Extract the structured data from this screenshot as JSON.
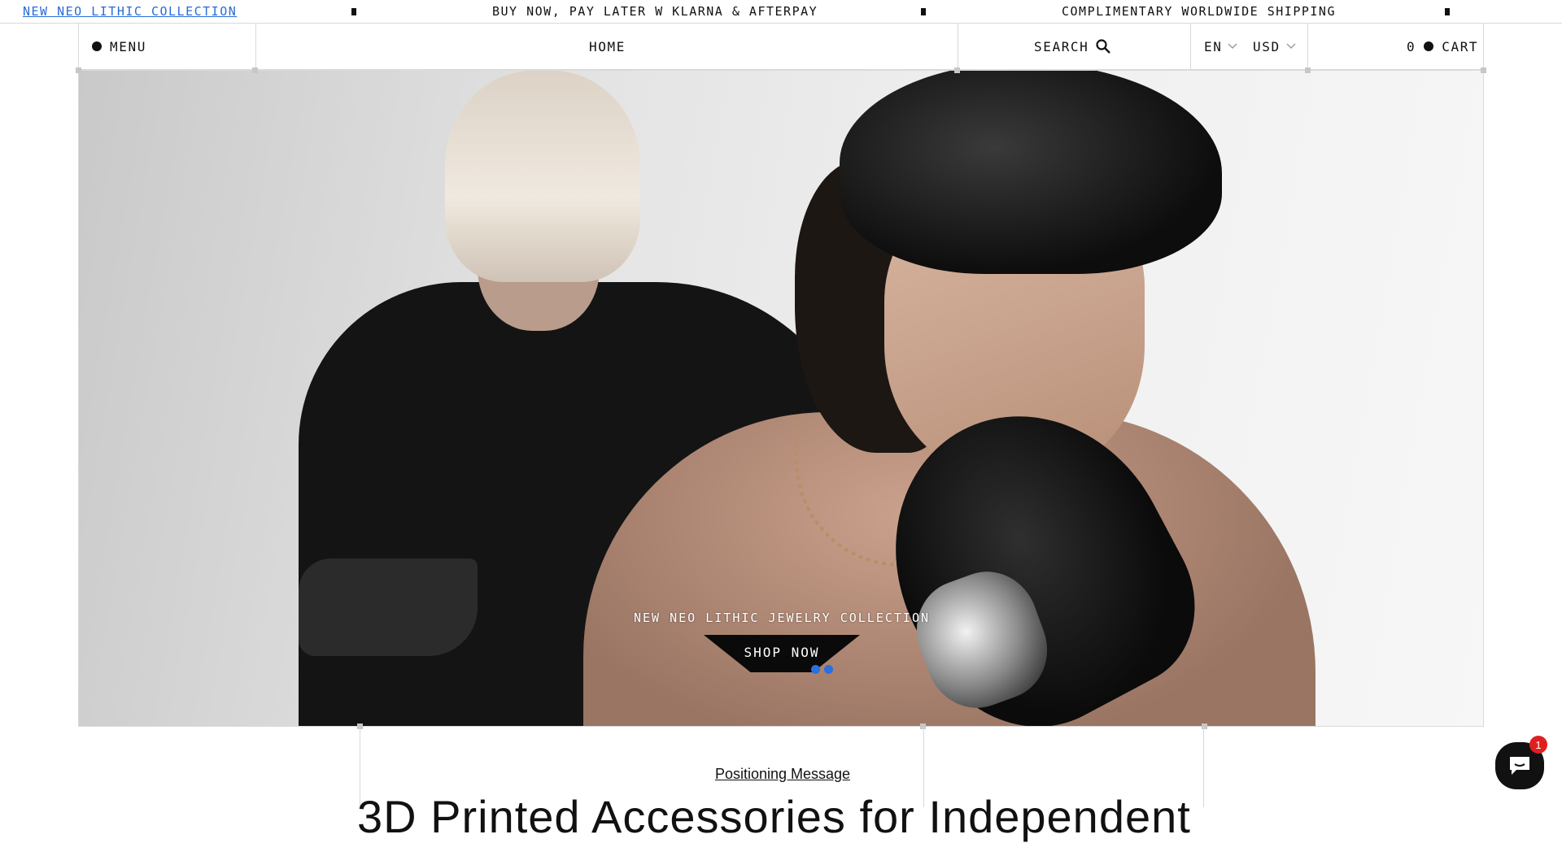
{
  "announcement": {
    "link_text": "NEW NEO LITHIC COLLECTION",
    "message_1": "BUY NOW, PAY LATER W KLARNA & AFTERPAY",
    "message_2": "COMPLIMENTARY WORLDWIDE SHIPPING"
  },
  "header": {
    "menu_label": "MENU",
    "home_label": "HOME",
    "search_label": "SEARCH",
    "language": "EN",
    "currency": "USD",
    "cart_count": "0",
    "cart_label": "CART"
  },
  "hero": {
    "caption": "NEW NEO LITHIC JEWELRY COLLECTION",
    "cta_label": "SHOP NOW",
    "slide_count": 2,
    "dot_color": "#2c6fe0"
  },
  "below": {
    "positioning_link": "Positioning Message",
    "heading": "3D Printed Accessories for Independent"
  },
  "chat": {
    "badge_count": "1"
  }
}
